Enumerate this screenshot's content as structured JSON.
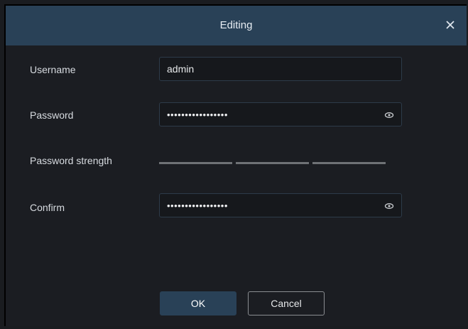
{
  "dialog": {
    "title": "Editing",
    "close_icon": "close-icon"
  },
  "form": {
    "username_label": "Username",
    "username_value": "admin",
    "password_label": "Password",
    "password_mask": "•••••••••••••••••",
    "password_strength_label": "Password strength",
    "password_strength_level": 0,
    "confirm_label": "Confirm",
    "confirm_mask": "•••••••••••••••••",
    "eye_icon": "eye-icon"
  },
  "buttons": {
    "ok_label": "OK",
    "cancel_label": "Cancel"
  },
  "colors": {
    "titlebar": "#294157",
    "background": "#1b1d22",
    "accent_button": "#294157",
    "strength_bar_inactive": "#6f7276"
  }
}
